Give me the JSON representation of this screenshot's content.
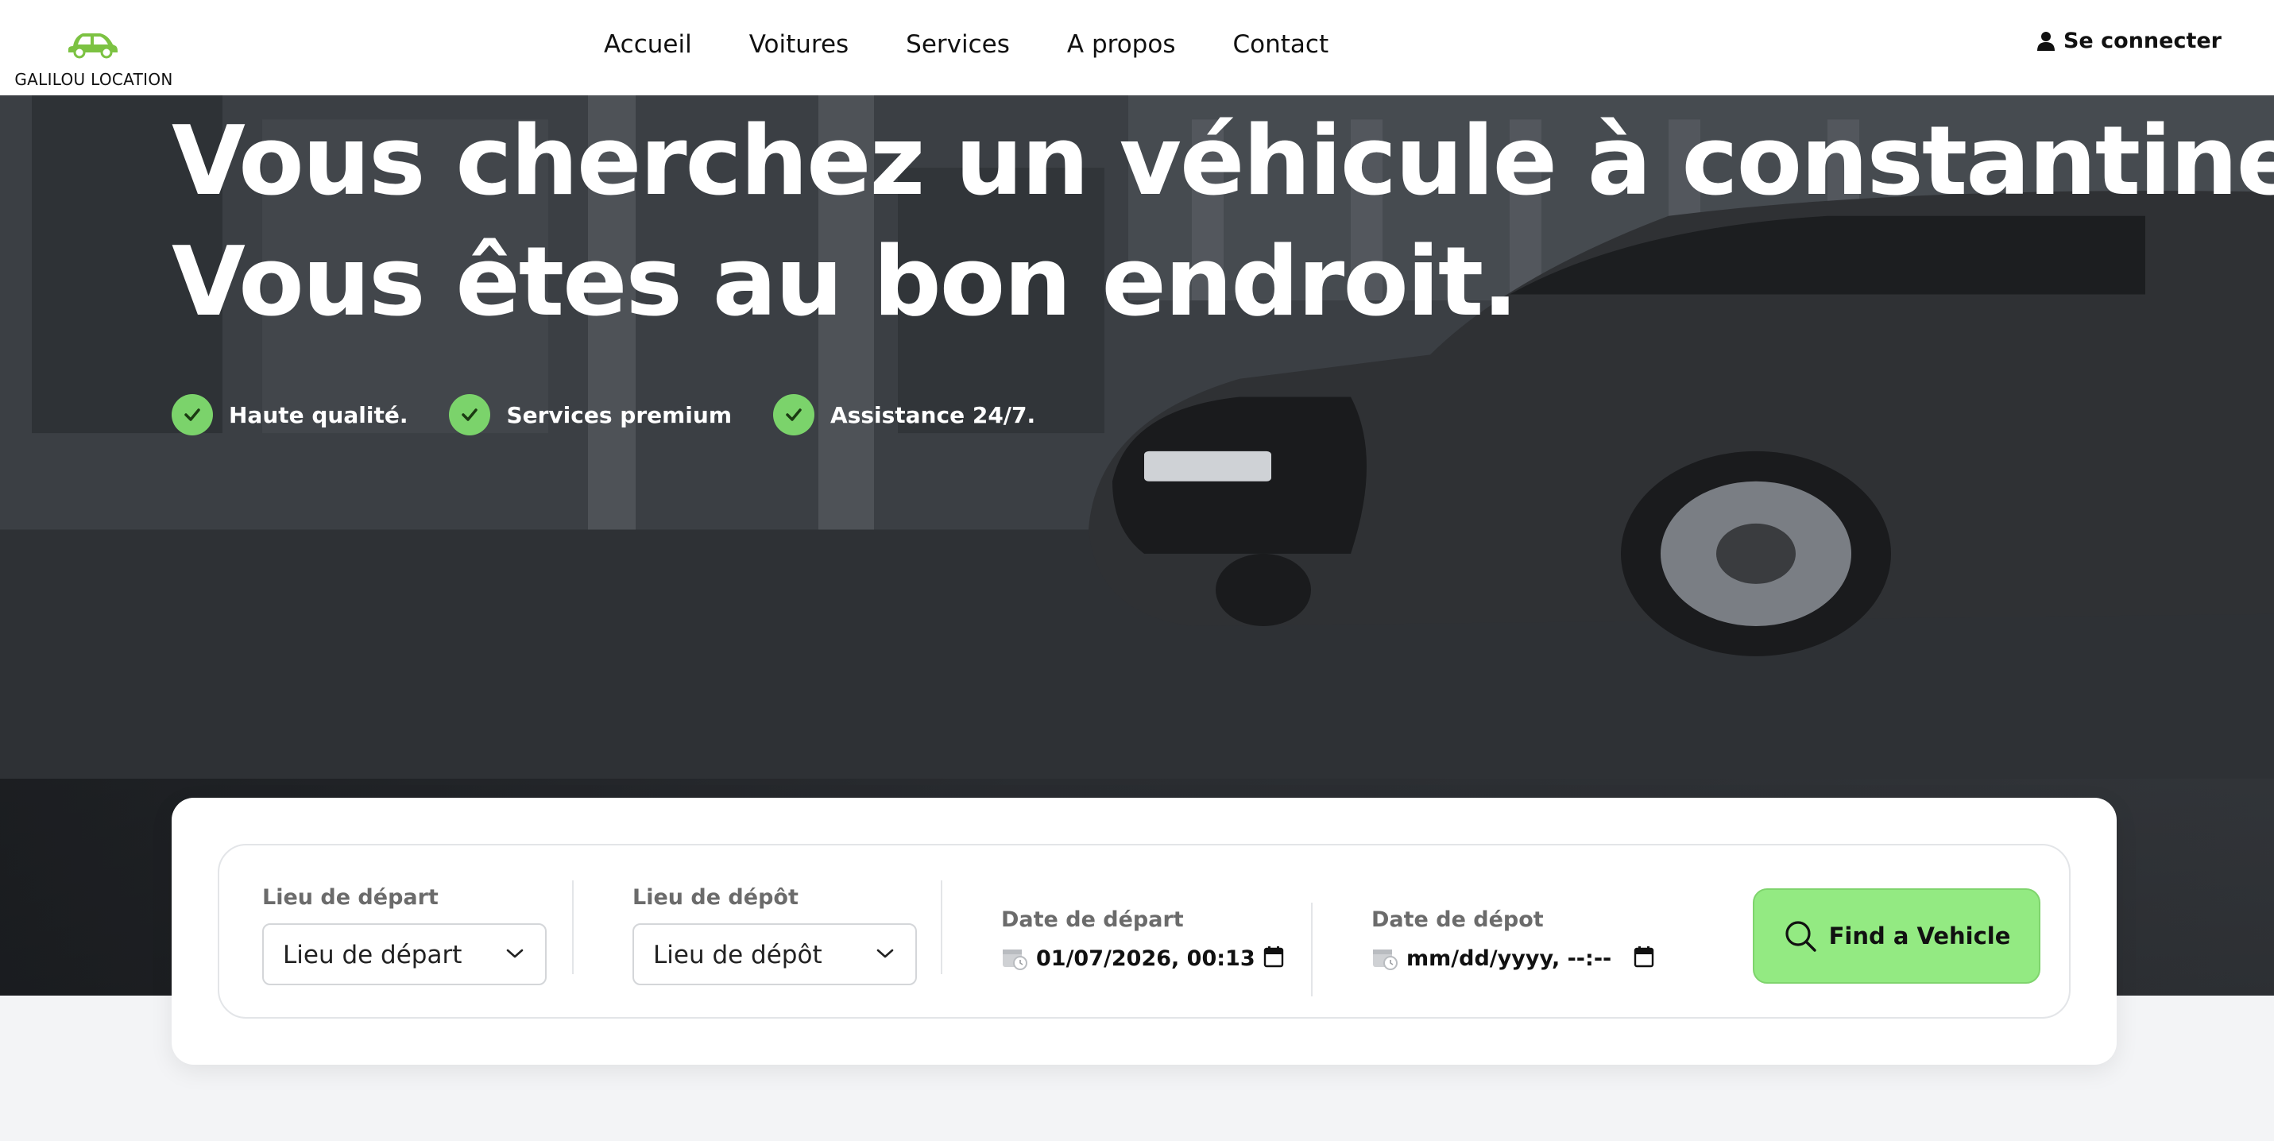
{
  "brand": {
    "name": "GALILOU LOCATION",
    "icon": "car-icon",
    "accent": "#7cc242"
  },
  "nav": {
    "items": [
      {
        "label": "Accueil"
      },
      {
        "label": "Voitures"
      },
      {
        "label": "Services"
      },
      {
        "label": "A propos"
      },
      {
        "label": "Contact"
      }
    ],
    "login_label": "Se connecter",
    "login_icon": "user-icon"
  },
  "hero": {
    "title_line1": "Vous cherchez un véhicule à constantine ?",
    "title_line2": "Vous êtes au bon endroit.",
    "features": [
      {
        "label": "Haute qualité.",
        "icon": "check-icon"
      },
      {
        "label": "Services premium",
        "icon": "check-icon"
      },
      {
        "label": "Assistance 24/7.",
        "icon": "check-icon"
      }
    ],
    "check_color": "#7bd36b"
  },
  "search": {
    "pickup": {
      "label": "Lieu de départ",
      "value": "Lieu de départ"
    },
    "dropoff": {
      "label": "Lieu de dépôt",
      "value": "Lieu de dépôt"
    },
    "start_date": {
      "label": "Date de départ",
      "value": "01/07/2026, 00:13"
    },
    "end_date": {
      "label": "Date de dépot",
      "value": "mm/dd/yyyy, --:--"
    },
    "button_label": "Find a Vehicle",
    "button_icon": "search-icon",
    "button_color": "#93ea82"
  }
}
